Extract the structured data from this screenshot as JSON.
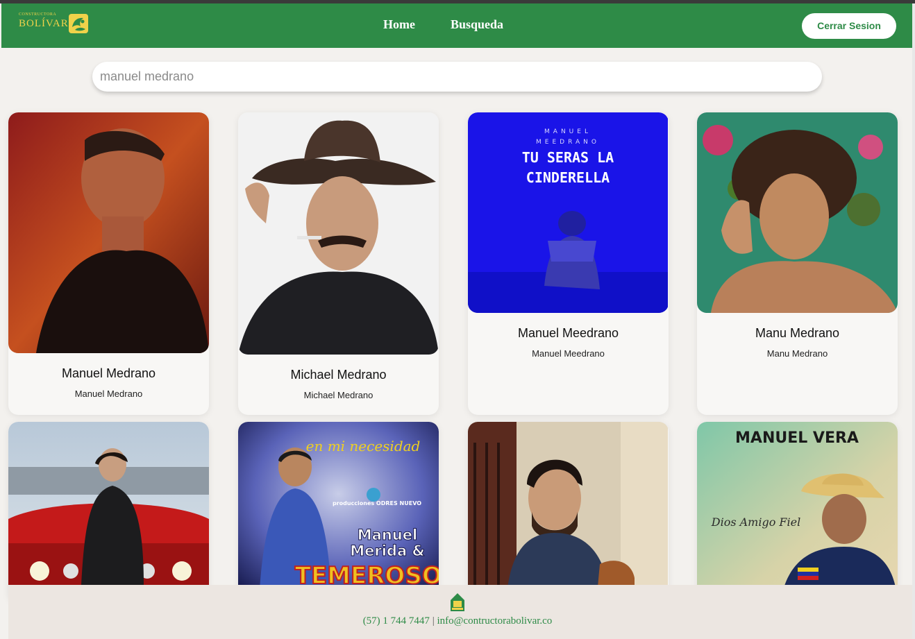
{
  "header": {
    "logo_small": "CONSTRUCTORA",
    "logo_big": "BOLÍVAR",
    "nav": [
      {
        "label": "Home"
      },
      {
        "label": "Busqueda"
      }
    ],
    "logout_label": "Cerrar Sesion"
  },
  "search": {
    "value": "manuel medrano"
  },
  "results": [
    {
      "title": "Manuel Medrano",
      "subtitle": "Manuel Medrano"
    },
    {
      "title": "Michael Medrano",
      "subtitle": "Michael Medrano"
    },
    {
      "title": "Manuel Meedrano",
      "subtitle": "Manuel Meedrano",
      "image_text": {
        "artist_line1": "MANUEL",
        "artist_line2": "MEEDRANO",
        "song_line1": "TU SERAS LA",
        "song_line2": "CINDERELLA"
      }
    },
    {
      "title": "Manu Medrano",
      "subtitle": "Manu Medrano"
    },
    {
      "title": "",
      "subtitle": ""
    },
    {
      "title": "",
      "subtitle": "",
      "image_text": {
        "tagline": "en mi necesidad",
        "label": "producciones ODRES NUEVO",
        "artist_line1": "Manuel",
        "artist_line2": "Merida &",
        "band": "TEMEROSOS"
      }
    },
    {
      "title": "",
      "subtitle": ""
    },
    {
      "title": "",
      "subtitle": "",
      "image_text": {
        "artist": "MANUEL VERA",
        "album": "Dios Amigo Fiel"
      }
    }
  ],
  "footer": {
    "phone": "(57) 1 744 7447",
    "separator": "|",
    "email": "info@contructorabolivar.co"
  },
  "colors": {
    "brand_green": "#2e8b47",
    "logo_gold": "#f0d24a",
    "page_bg": "#f3f1ee",
    "footer_bg": "#ece6e1"
  }
}
